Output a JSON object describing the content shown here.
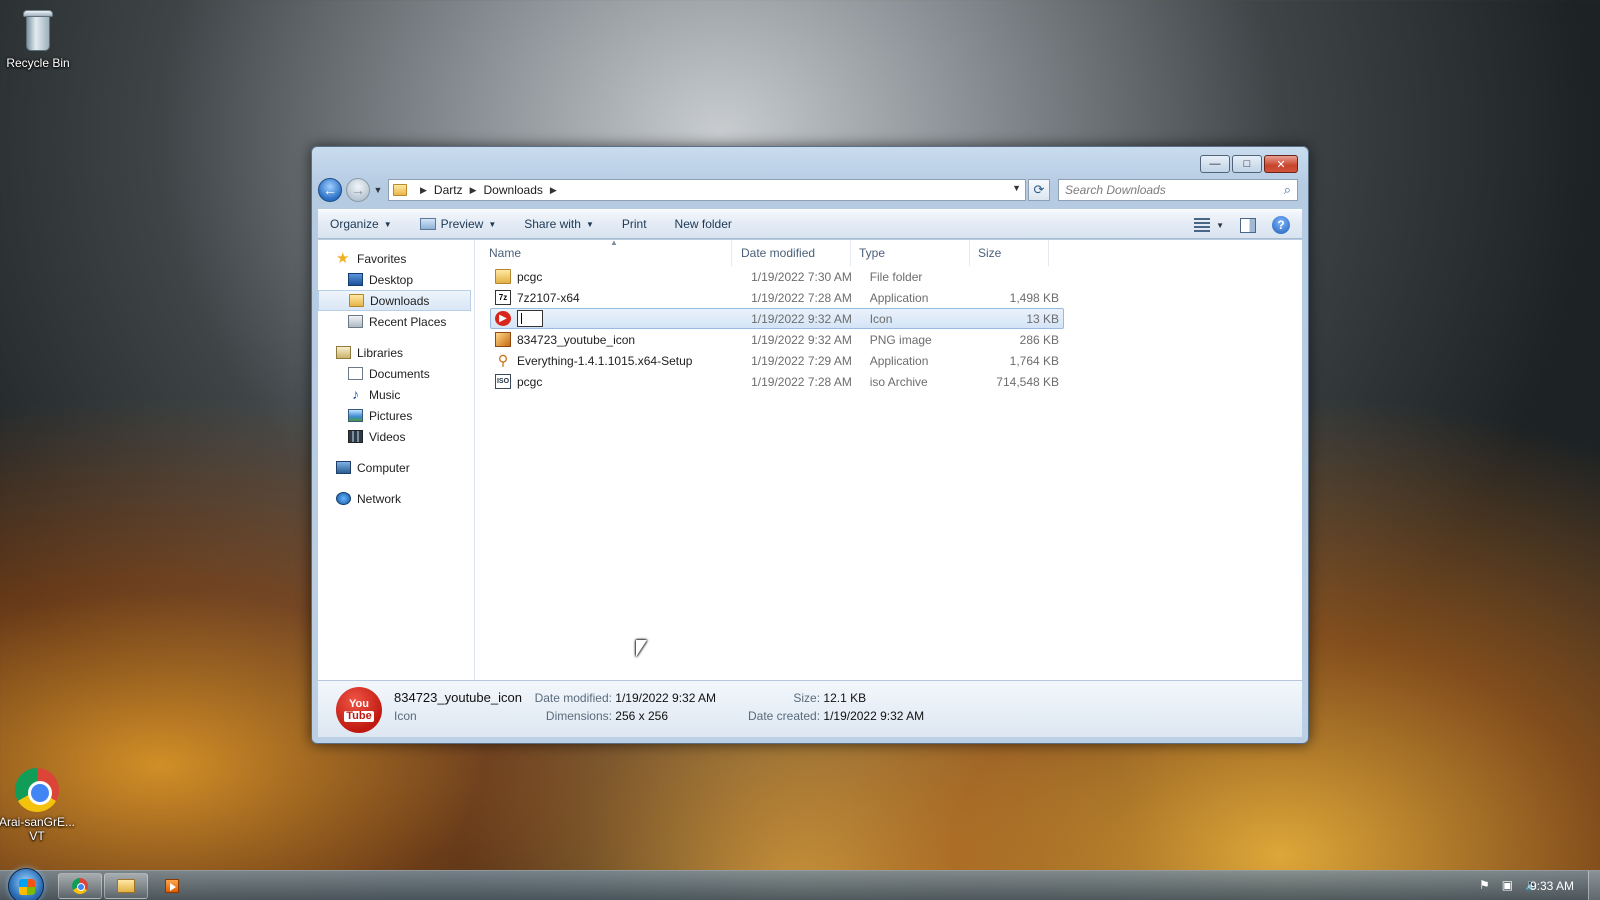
{
  "desktop": {
    "icons": [
      {
        "label": "Recycle Bin",
        "icon": "recycle-bin-icon"
      },
      {
        "label": "Arai-sanGrE...",
        "label2": "VT",
        "icon": "chrome-shortcut-icon"
      }
    ]
  },
  "window": {
    "caption": {
      "minimize": "—",
      "maximize": "□",
      "close": "✕"
    },
    "breadcrumb": [
      "Dartz",
      "Downloads"
    ],
    "search_placeholder": "Search Downloads",
    "toolbar": {
      "organize": "Organize",
      "preview": "Preview",
      "share_with": "Share with",
      "print": "Print",
      "new_folder": "New folder"
    },
    "nav": {
      "favorites": {
        "label": "Favorites",
        "items": [
          "Desktop",
          "Downloads",
          "Recent Places"
        ]
      },
      "libraries": {
        "label": "Libraries",
        "items": [
          "Documents",
          "Music",
          "Pictures",
          "Videos"
        ]
      },
      "computer": "Computer",
      "network": "Network",
      "selected": "Downloads"
    },
    "columns": {
      "name": "Name",
      "date": "Date modified",
      "type": "Type",
      "size": "Size"
    },
    "files": [
      {
        "name": "pcgc",
        "date": "1/19/2022 7:30 AM",
        "type": "File folder",
        "size": "",
        "icon": "folder-icon"
      },
      {
        "name": "7z2107-x64",
        "date": "1/19/2022 7:28 AM",
        "type": "Application",
        "size": "1,498 KB",
        "icon": "7zip-app-icon"
      },
      {
        "name": "",
        "date": "1/19/2022 9:32 AM",
        "type": "Icon",
        "size": "13 KB",
        "icon": "youtube-ico-icon",
        "renaming": true
      },
      {
        "name": "834723_youtube_icon",
        "date": "1/19/2022 9:32 AM",
        "type": "PNG image",
        "size": "286 KB",
        "icon": "png-image-icon"
      },
      {
        "name": "Everything-1.4.1.1015.x64-Setup",
        "date": "1/19/2022 7:29 AM",
        "type": "Application",
        "size": "1,764 KB",
        "icon": "everything-search-icon"
      },
      {
        "name": "pcgc",
        "date": "1/19/2022 7:28 AM",
        "type": "iso Archive",
        "size": "714,548 KB",
        "icon": "iso-archive-icon"
      }
    ],
    "details": {
      "name": "834723_youtube_icon",
      "type": "Icon",
      "date_modified_label": "Date modified:",
      "date_modified": "1/19/2022 9:32 AM",
      "dimensions_label": "Dimensions:",
      "dimensions": "256 x 256",
      "size_label": "Size:",
      "size": "12.1 KB",
      "date_created_label": "Date created:",
      "date_created": "1/19/2022 9:32 AM",
      "thumb_top": "You",
      "thumb_bottom": "Tube"
    }
  },
  "taskbar": {
    "clock": "9:33 AM",
    "tray_icons": [
      "flag-icon",
      "network-icon",
      "volume-icon"
    ]
  }
}
